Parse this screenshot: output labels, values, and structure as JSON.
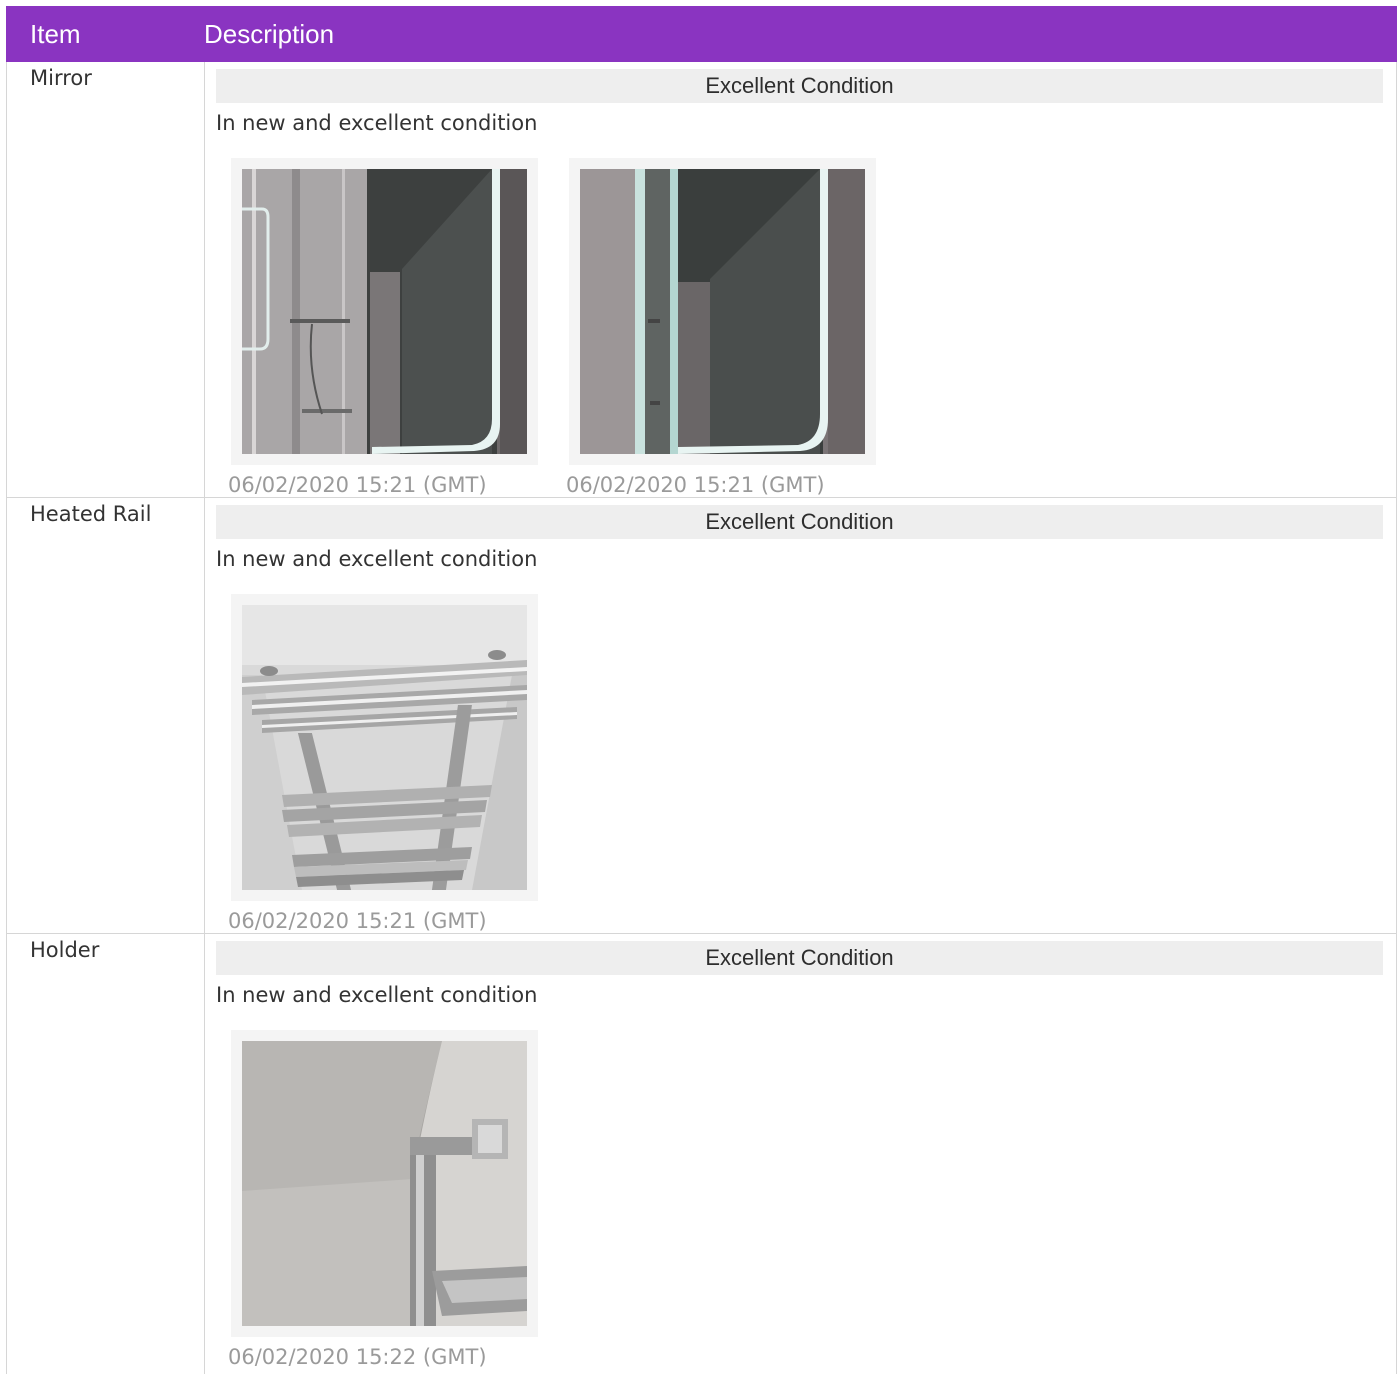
{
  "header": {
    "item_label": "Item",
    "description_label": "Description"
  },
  "colors": {
    "header_bg": "#8a34c1",
    "header_text": "#ffffff",
    "condition_bar_bg": "#eeeeee",
    "timestamp_text": "#9a9a9a"
  },
  "rows": [
    {
      "name": "Mirror",
      "condition": "Excellent Condition",
      "description": "In new and excellent condition",
      "photos": [
        {
          "timestamp": "06/02/2020 15:21 (GMT)"
        },
        {
          "timestamp": "06/02/2020 15:21 (GMT)"
        }
      ]
    },
    {
      "name": "Heated Rail",
      "condition": "Excellent Condition",
      "description": "In new and excellent condition",
      "photos": [
        {
          "timestamp": "06/02/2020 15:21 (GMT)"
        }
      ]
    },
    {
      "name": "Holder",
      "condition": "Excellent Condition",
      "description": "In new and excellent condition",
      "photos": [
        {
          "timestamp": "06/02/2020 15:22 (GMT)"
        }
      ]
    }
  ]
}
